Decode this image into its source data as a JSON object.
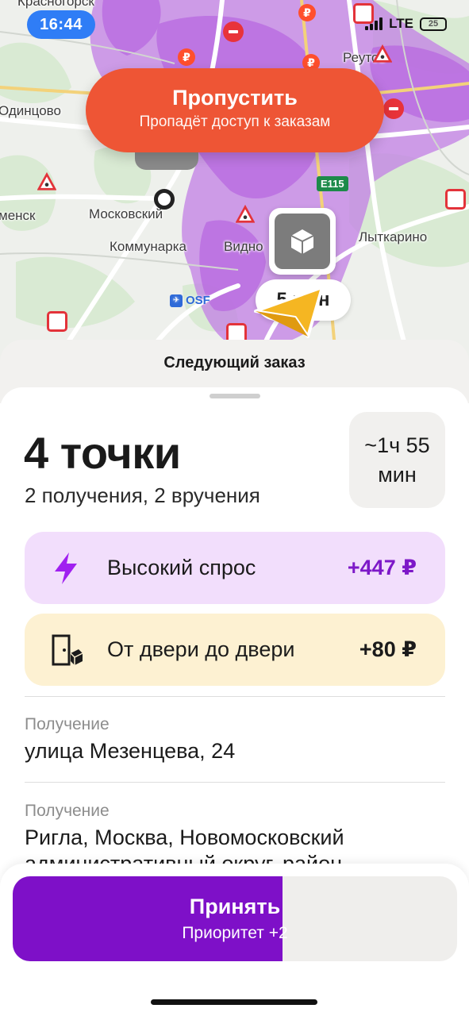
{
  "status_bar": {
    "time": "16:44",
    "network": "LTE",
    "battery": "25"
  },
  "map": {
    "labels": {
      "krasnogorsk": "Красногорск",
      "odintsovo": "Одинцово",
      "reutov": "Реутов",
      "moskovsky": "Московский",
      "kommunarka": "Коммунарка",
      "vidnoe": "Видно",
      "lytkarino": "Лыткарино",
      "menskaya": "менск",
      "airport": "OSF",
      "road": "E115"
    },
    "eta": "5 мин",
    "colors": {
      "demand_heat": "#c07ae8",
      "road": "#ffffff"
    }
  },
  "skip": {
    "title": "Пропустить",
    "subtitle": "Пропадёт доступ к заказам",
    "color": "#ee5535"
  },
  "sheet": {
    "header": "Следующий заказ",
    "points_title": "4 точки",
    "points_subtitle": "2 получения, 2 вручения",
    "duration_line1": "~1ч 55",
    "duration_line2": "мин"
  },
  "bonuses": [
    {
      "icon": "lightning-icon",
      "label": "Высокий спрос",
      "amount": "+447 ₽",
      "color": "#7d18c8"
    },
    {
      "icon": "door-box-icon",
      "label": "От двери до двери",
      "amount": "+80 ₽",
      "color": "#1b1b1b"
    }
  ],
  "stops": [
    {
      "type": "Получение",
      "address": "улица Мезенцева, 24"
    },
    {
      "type": "Получение",
      "address": "Ригла, Москва, Новомосковский административный округ, район"
    }
  ],
  "accept": {
    "title": "Принять",
    "subtitle": "Приоритет +2",
    "progress": 0.608,
    "color": "#7e10c8"
  }
}
